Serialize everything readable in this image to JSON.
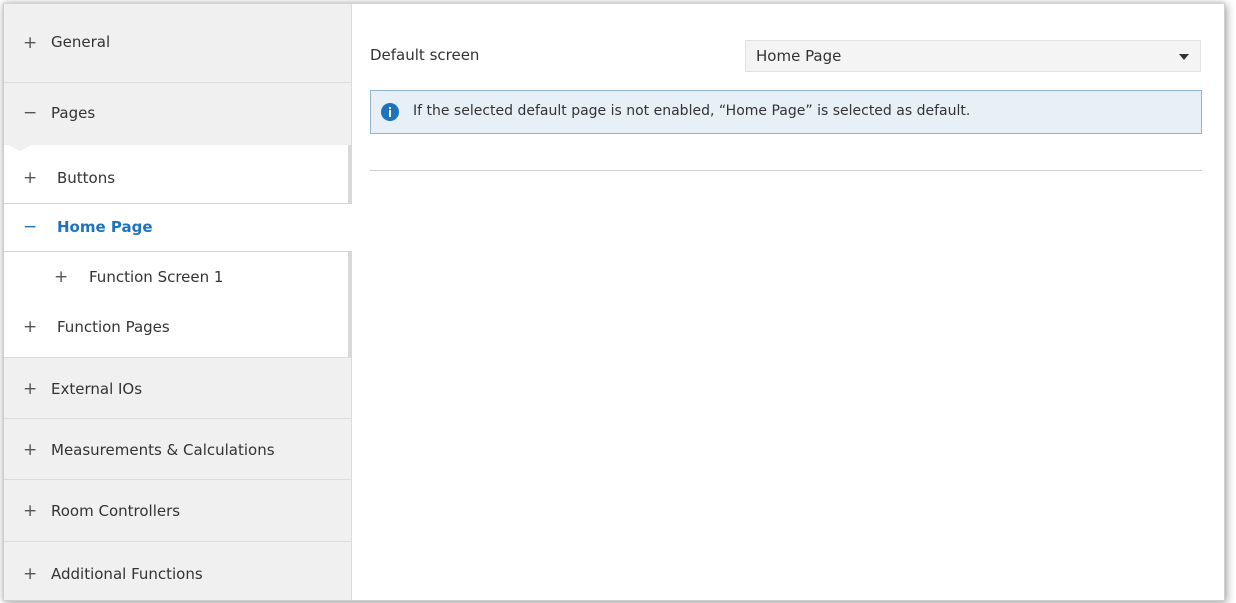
{
  "sidebar": {
    "items": [
      {
        "sign": "+",
        "label": "General"
      },
      {
        "sign": "−",
        "label": "Pages"
      },
      {
        "sign": "+",
        "label": "External IOs"
      },
      {
        "sign": "+",
        "label": "Measurements & Calculations"
      },
      {
        "sign": "+",
        "label": "Room Controllers"
      },
      {
        "sign": "+",
        "label": "Additional Functions"
      }
    ],
    "sub_items": [
      {
        "sign": "+",
        "label": "Buttons"
      },
      {
        "sign": "−",
        "label": "Home Page",
        "selected": true
      },
      {
        "sign": "+",
        "label": "Function Screen 1"
      },
      {
        "sign": "+",
        "label": "Function Pages"
      }
    ]
  },
  "main": {
    "default_screen": {
      "label": "Default screen",
      "value": "Home Page"
    },
    "info": {
      "text": "If the selected default page is not enabled, “Home Page” is selected as default.",
      "icon": "info-icon"
    }
  },
  "colors": {
    "accent": "#1e73be",
    "info_bg": "#e8f0f7",
    "info_border": "#8fb4d4",
    "sidebar_bg": "#f0f0f0"
  }
}
